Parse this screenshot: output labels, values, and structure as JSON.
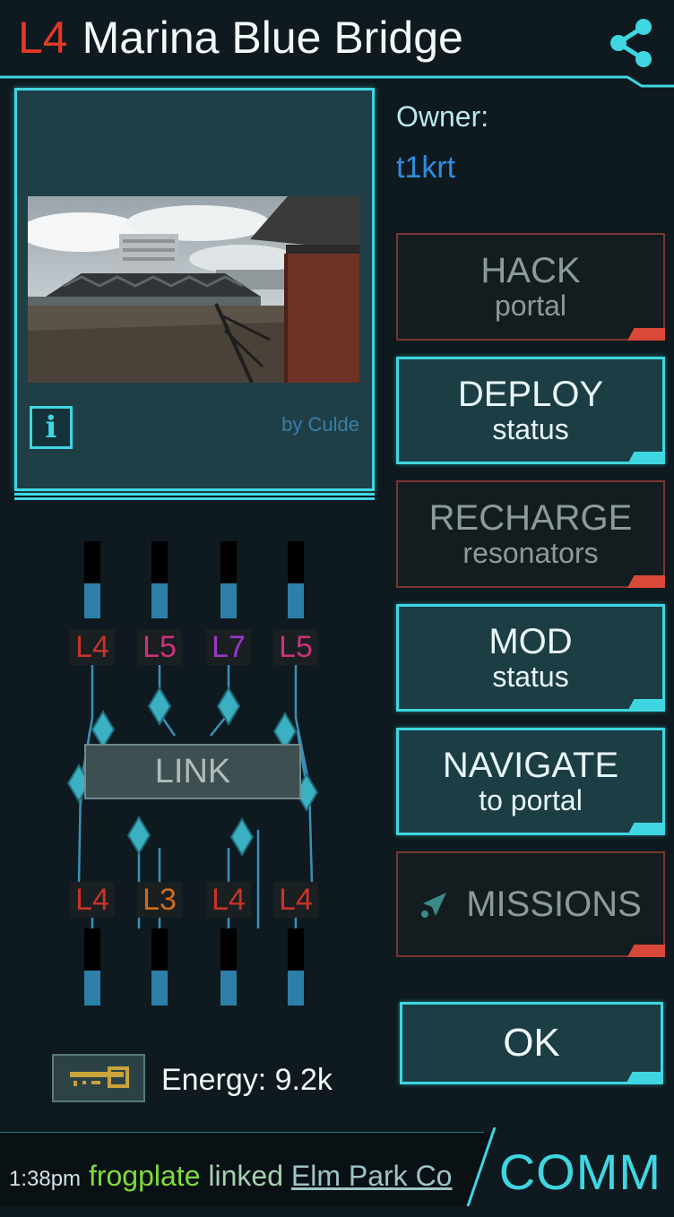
{
  "header": {
    "level": "L4",
    "portal_name": "Marina Blue Bridge",
    "share_icon": "share-icon"
  },
  "owner": {
    "label": "Owner:",
    "name": "t1krt"
  },
  "photo": {
    "byline": "by Culde",
    "info_icon": "i"
  },
  "actions": {
    "hack": {
      "line1": "HACK",
      "line2": "portal"
    },
    "deploy": {
      "line1": "DEPLOY",
      "line2": "status"
    },
    "recharge": {
      "line1": "RECHARGE",
      "line2": "resonators"
    },
    "mod": {
      "line1": "MOD",
      "line2": "status"
    },
    "navigate": {
      "line1": "NAVIGATE",
      "line2": "to portal"
    },
    "missions": {
      "label": "MISSIONS",
      "icon": "mission-arrow-icon"
    },
    "ok": "OK"
  },
  "resonators": {
    "top": [
      {
        "level": "L4",
        "color": "#c8332a",
        "charge": 0.45
      },
      {
        "level": "L5",
        "color": "#c8327a",
        "charge": 0.45
      },
      {
        "level": "L7",
        "color": "#9a38c8",
        "charge": 0.45
      },
      {
        "level": "L5",
        "color": "#c8327a",
        "charge": 0.45
      }
    ],
    "bottom": [
      {
        "level": "L4",
        "color": "#c8332a",
        "charge": 0.45
      },
      {
        "level": "L3",
        "color": "#d06d1c",
        "charge": 0.45
      },
      {
        "level": "L4",
        "color": "#c8332a",
        "charge": 0.45
      },
      {
        "level": "L4",
        "color": "#c8332a",
        "charge": 0.45
      }
    ],
    "link_label": "LINK"
  },
  "energy": {
    "label": "Energy: 9.2k",
    "key_icon": "key-icon"
  },
  "comm": {
    "time": "1:38pm",
    "player": "frogplate",
    "verb": "linked",
    "portal": "Elm Park Co",
    "button": "COMM"
  },
  "colors": {
    "accent": "#3fd6e2",
    "enlightened_green": "#7ddc3a",
    "resistance_blue": "#2e8ee0",
    "alert_red": "#d94838"
  }
}
